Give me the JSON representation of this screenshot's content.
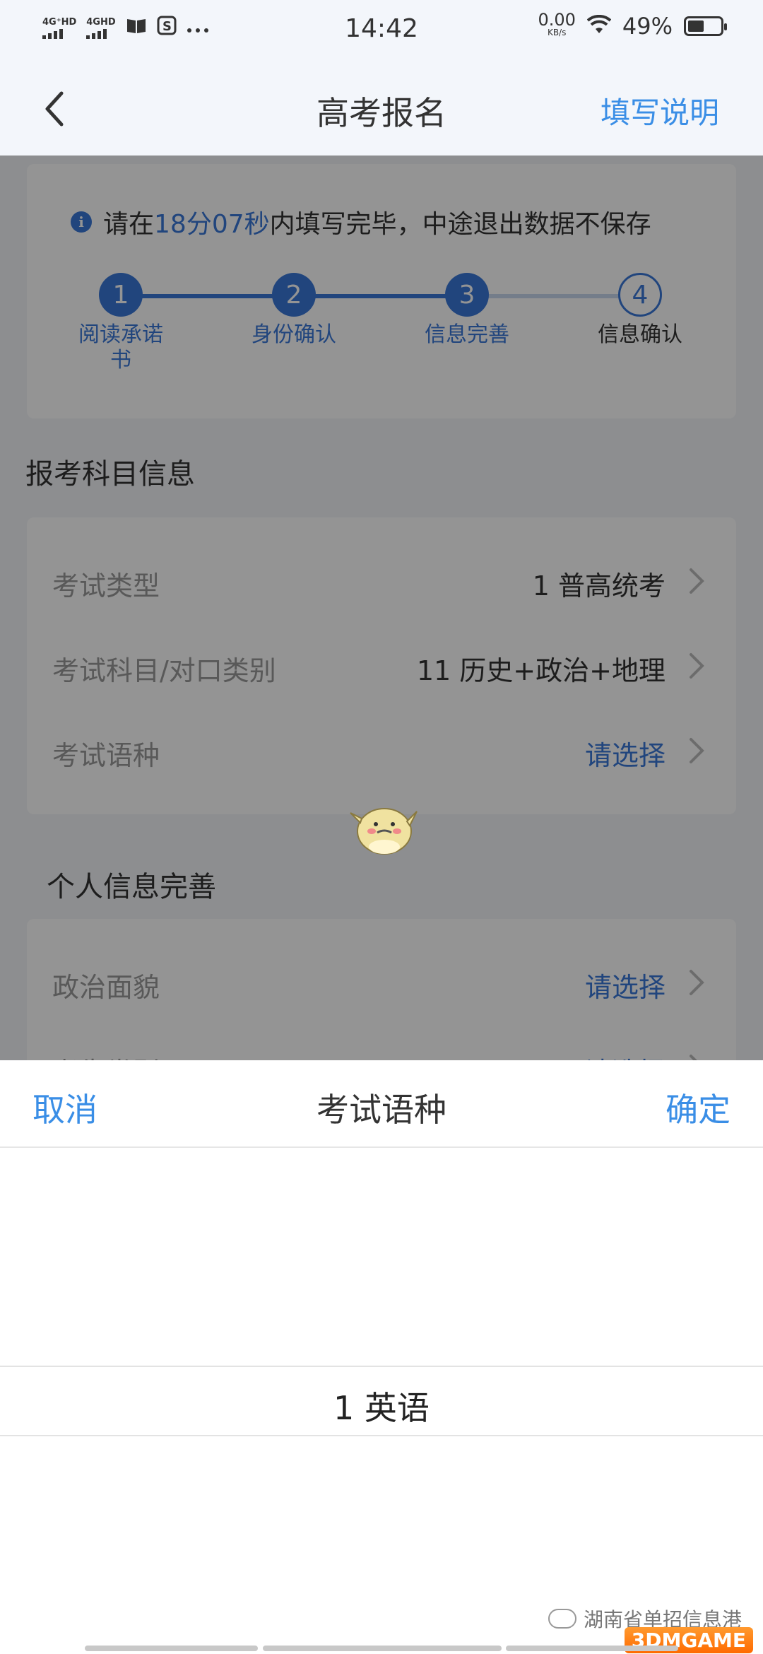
{
  "status_bar": {
    "net1": "4G⁺HD",
    "net2": "4GHD",
    "time": "14:42",
    "speed_value": "0.00",
    "speed_unit": "KB/s",
    "battery": "49%",
    "battery_level": 0.49
  },
  "nav": {
    "title": "高考报名",
    "help": "填写说明"
  },
  "timer": {
    "prefix": "请在",
    "time": "18分07秒",
    "suffix": "内填写完毕，中途退出数据不保存"
  },
  "steps": [
    {
      "num": "1",
      "label": "阅读承诺书",
      "done": true
    },
    {
      "num": "2",
      "label": "身份确认",
      "done": true
    },
    {
      "num": "3",
      "label": "信息完善",
      "done": true
    },
    {
      "num": "4",
      "label": "信息确认",
      "done": false
    }
  ],
  "exam_section": {
    "title": "报考科目信息",
    "rows": [
      {
        "label": "考试类型",
        "value": "1 普高统考"
      },
      {
        "label": "考试科目/对口类别",
        "value": "11 历史+政治+地理"
      },
      {
        "label": "考试语种",
        "value": "请选择"
      }
    ]
  },
  "personal_section": {
    "title": "个人信息完善",
    "rows": [
      {
        "label": "政治面貌",
        "value": "请选择"
      },
      {
        "label": "考生类别",
        "value": "请选择"
      }
    ]
  },
  "sheet": {
    "cancel": "取消",
    "title": "考试语种",
    "confirm": "确定",
    "selected_option": "1 英语"
  },
  "watermark": {
    "text": "湖南省单招信息港",
    "brand": "3DMGAME"
  },
  "colors": {
    "accent": "#3a78d8",
    "link": "#3a8ee6"
  }
}
